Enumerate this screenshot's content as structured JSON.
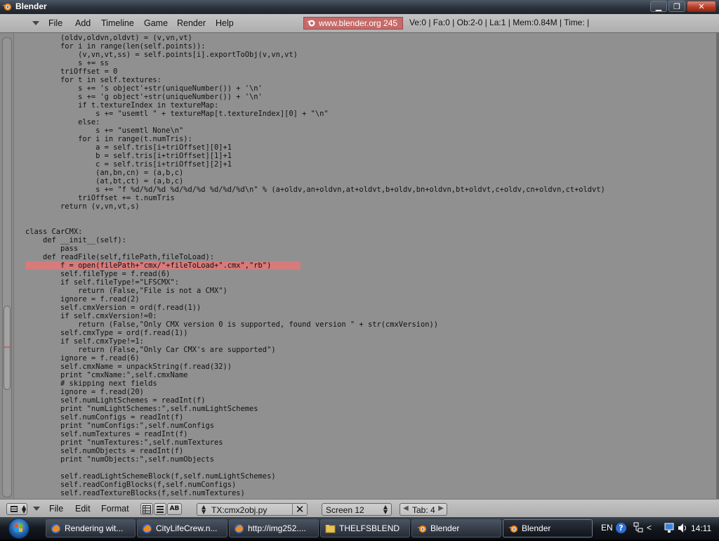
{
  "window": {
    "title": "Blender",
    "buttons": {
      "minimize": "▁",
      "maximize": "❐",
      "close": "✕"
    }
  },
  "header": {
    "menus": [
      "File",
      "Add",
      "Timeline",
      "Game",
      "Render",
      "Help"
    ],
    "logo_text": "www.blender.org 245",
    "stats": "Ve:0 | Fa:0 | Ob:2-0 | La:1  | Mem:0.84M  | Time: |"
  },
  "editor": {
    "highlighted_line": 27,
    "lines": [
      "        (oldv,oldvn,oldvt) = (v,vn,vt)",
      "        for i in range(len(self.points)):",
      "            (v,vn,vt,ss) = self.points[i].exportToObj(v,vn,vt)",
      "            s += ss",
      "        triOffset = 0",
      "        for t in self.textures:",
      "            s += 's object'+str(uniqueNumber()) + '\\n'",
      "            s += 'g object'+str(uniqueNumber()) + '\\n'",
      "            if t.textureIndex in textureMap:",
      "                s += \"usemtl \" + textureMap[t.textureIndex][0] + \"\\n\"",
      "            else:",
      "                s += \"usemtl None\\n\"",
      "            for i in range(t.numTris):",
      "                a = self.tris[i+triOffset][0]+1",
      "                b = self.tris[i+triOffset][1]+1",
      "                c = self.tris[i+triOffset][2]+1",
      "                (an,bn,cn) = (a,b,c)",
      "                (at,bt,ct) = (a,b,c)",
      "                s += \"f %d/%d/%d %d/%d/%d %d/%d/%d\\n\" % (a+oldv,an+oldvn,at+oldvt,b+oldv,bn+oldvn,bt+oldvt,c+oldv,cn+oldvn,ct+oldvt)",
      "            triOffset += t.numTris",
      "        return (v,vn,vt,s)",
      "",
      "",
      "class CarCMX:",
      "    def __init__(self):",
      "        pass",
      "    def readFile(self,filePath,fileToLoad):",
      "        f = open(filePath+\"cmx/\"+fileToLoad+\".cmx\",\"rb\")",
      "        self.fileType = f.read(6)",
      "        if self.fileType!=\"LFSCMX\":",
      "            return (False,\"File is not a CMX\")",
      "        ignore = f.read(2)",
      "        self.cmxVersion = ord(f.read(1))",
      "        if self.cmxVersion!=0:",
      "            return (False,\"Only CMX version 0 is supported, found version \" + str(cmxVersion))",
      "        self.cmxType = ord(f.read(1))",
      "        if self.cmxType!=1:",
      "            return (False,\"Only Car CMX's are supported\")",
      "        ignore = f.read(6)",
      "        self.cmxName = unpackString(f.read(32))",
      "        print \"cmxName:\",self.cmxName",
      "        # skipping next fields",
      "        ignore = f.read(20)",
      "        self.numLightSchemes = readInt(f)",
      "        print \"numLightSchemes:\",self.numLightSchemes",
      "        self.numConfigs = readInt(f)",
      "        print \"numConfigs:\",self.numConfigs",
      "        self.numTextures = readInt(f)",
      "        print \"numTextures:\",self.numTextures",
      "        self.numObjects = readInt(f)",
      "        print \"numObjects:\",self.numObjects",
      "",
      "        self.readLightSchemeBlock(f,self.numLightSchemes)",
      "        self.readConfigBlocks(f,self.numConfigs)",
      "        self.readTextureBlocks(f,self.numTextures)"
    ]
  },
  "footer": {
    "menus": [
      "File",
      "Edit",
      "Format"
    ],
    "toggle_labels": [
      "",
      "",
      "AB"
    ],
    "text_name": "TX:cmx2obj.py",
    "text_close": "✕",
    "screen_name": "Screen 12",
    "tab_label": "Tab: 4"
  },
  "taskbar": {
    "tasks": [
      {
        "label": "Rendering wit...",
        "icon": "firefox-icon"
      },
      {
        "label": "CityLifeCrew.n...",
        "icon": "firefox-icon"
      },
      {
        "label": "http://img252....",
        "icon": "firefox-icon"
      },
      {
        "label": "THELFSBLEND",
        "icon": "folder-icon"
      },
      {
        "label": "Blender",
        "icon": "blender-icon"
      },
      {
        "label": "Blender",
        "icon": "blender-icon",
        "active": true
      }
    ],
    "language": "EN",
    "clock": "14:11"
  },
  "colors": {
    "highlight": "#d77a7a",
    "logo_bg": "#c66a6a",
    "editor_bg": "#909090"
  }
}
